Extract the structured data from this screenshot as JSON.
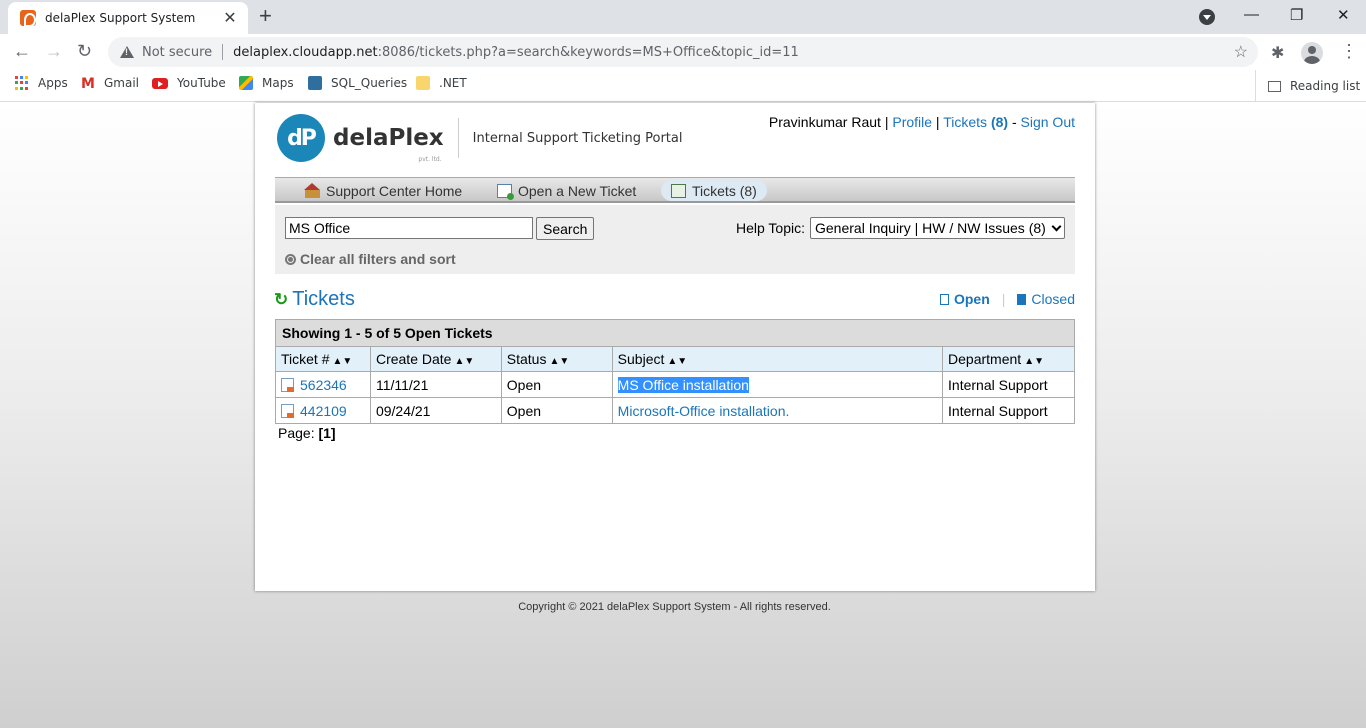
{
  "browser": {
    "tab_title": "delaPlex Support System",
    "not_secure": "Not secure",
    "url_host": "delaplex.cloudapp.net",
    "url_rest": ":8086/tickets.php?a=search&keywords=MS+Office&topic_id=11",
    "bookmarks": [
      "Apps",
      "Gmail",
      "YouTube",
      "Maps",
      "SQL_Queries",
      ".NET"
    ],
    "reading_list": "Reading list"
  },
  "header": {
    "logo_mark": "dP",
    "logo_text": "delaPlex",
    "logo_sub": "pvt. ltd.",
    "portal_title": "Internal Support Ticketing Portal",
    "user_name": "Pravinkumar Raut",
    "profile": "Profile",
    "tickets": "Tickets",
    "tickets_count": "(8)",
    "sign_out": "Sign Out"
  },
  "nav": {
    "home": "Support Center Home",
    "new_ticket": "Open a New Ticket",
    "tickets": "Tickets (8)"
  },
  "search": {
    "value": "MS Office",
    "button": "Search",
    "help_label": "Help Topic:",
    "help_value": "General Inquiry | HW / NW Issues (8)",
    "clear": "Clear all filters and sort"
  },
  "tickets": {
    "title": "Tickets",
    "open": "Open",
    "closed": "Closed",
    "showing": "Showing 1 - 5 of 5 Open Tickets",
    "columns": [
      "Ticket #",
      "Create Date",
      "Status",
      "Subject",
      "Department"
    ],
    "rows": [
      {
        "number": "562346",
        "date": "11/11/21",
        "status": "Open",
        "subject": "MS Office installation",
        "department": "Internal Support"
      },
      {
        "number": "442109",
        "date": "09/24/21",
        "status": "Open",
        "subject": "Microsoft-Office installation.",
        "department": "Internal Support"
      }
    ],
    "page_label": "Page:",
    "page_value": "[1]"
  },
  "footer": "Copyright © 2021 delaPlex Support System - All rights reserved."
}
